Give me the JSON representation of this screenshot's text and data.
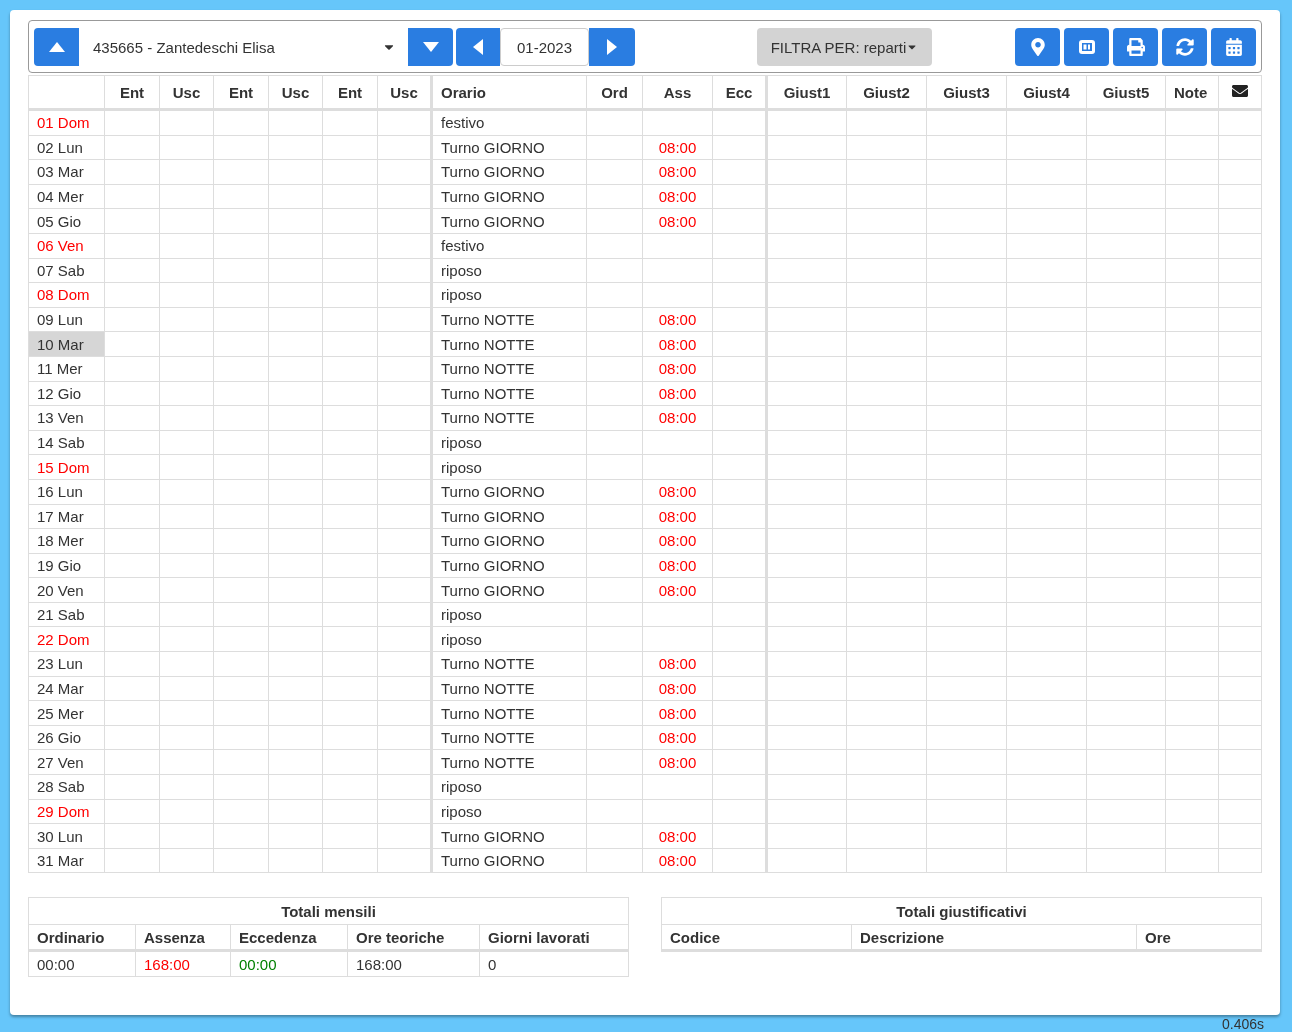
{
  "employee_select": {
    "value": "435665 - Zantedeschi Elisa"
  },
  "month_field": {
    "value": "01-2023"
  },
  "filter_button": {
    "label": "FILTRA PER: reparti"
  },
  "table": {
    "columns": [
      "Ent",
      "Usc",
      "Ent",
      "Usc",
      "Ent",
      "Usc",
      "Orario",
      "Ord",
      "Ass",
      "Ecc",
      "Giust1",
      "Giust2",
      "Giust3",
      "Giust4",
      "Giust5",
      "Note"
    ],
    "rows": [
      {
        "day": "01 Dom",
        "holiday": true,
        "selected": false,
        "orario": "festivo"
      },
      {
        "day": "02 Lun",
        "holiday": false,
        "selected": false,
        "orario": "Turno GIORNO",
        "ass": "08:00"
      },
      {
        "day": "03 Mar",
        "holiday": false,
        "selected": false,
        "orario": "Turno GIORNO",
        "ass": "08:00"
      },
      {
        "day": "04 Mer",
        "holiday": false,
        "selected": false,
        "orario": "Turno GIORNO",
        "ass": "08:00"
      },
      {
        "day": "05 Gio",
        "holiday": false,
        "selected": false,
        "orario": "Turno GIORNO",
        "ass": "08:00"
      },
      {
        "day": "06 Ven",
        "holiday": true,
        "selected": false,
        "orario": "festivo"
      },
      {
        "day": "07 Sab",
        "holiday": false,
        "selected": false,
        "orario": "riposo"
      },
      {
        "day": "08 Dom",
        "holiday": true,
        "selected": false,
        "orario": "riposo"
      },
      {
        "day": "09 Lun",
        "holiday": false,
        "selected": false,
        "orario": "Turno NOTTE",
        "ass": "08:00"
      },
      {
        "day": "10 Mar",
        "holiday": false,
        "selected": true,
        "orario": "Turno NOTTE",
        "ass": "08:00"
      },
      {
        "day": "11 Mer",
        "holiday": false,
        "selected": false,
        "orario": "Turno NOTTE",
        "ass": "08:00"
      },
      {
        "day": "12 Gio",
        "holiday": false,
        "selected": false,
        "orario": "Turno NOTTE",
        "ass": "08:00"
      },
      {
        "day": "13 Ven",
        "holiday": false,
        "selected": false,
        "orario": "Turno NOTTE",
        "ass": "08:00"
      },
      {
        "day": "14 Sab",
        "holiday": false,
        "selected": false,
        "orario": "riposo"
      },
      {
        "day": "15 Dom",
        "holiday": true,
        "selected": false,
        "orario": "riposo"
      },
      {
        "day": "16 Lun",
        "holiday": false,
        "selected": false,
        "orario": "Turno GIORNO",
        "ass": "08:00"
      },
      {
        "day": "17 Mar",
        "holiday": false,
        "selected": false,
        "orario": "Turno GIORNO",
        "ass": "08:00"
      },
      {
        "day": "18 Mer",
        "holiday": false,
        "selected": false,
        "orario": "Turno GIORNO",
        "ass": "08:00"
      },
      {
        "day": "19 Gio",
        "holiday": false,
        "selected": false,
        "orario": "Turno GIORNO",
        "ass": "08:00"
      },
      {
        "day": "20 Ven",
        "holiday": false,
        "selected": false,
        "orario": "Turno GIORNO",
        "ass": "08:00"
      },
      {
        "day": "21 Sab",
        "holiday": false,
        "selected": false,
        "orario": "riposo"
      },
      {
        "day": "22 Dom",
        "holiday": true,
        "selected": false,
        "orario": "riposo"
      },
      {
        "day": "23 Lun",
        "holiday": false,
        "selected": false,
        "orario": "Turno NOTTE",
        "ass": "08:00"
      },
      {
        "day": "24 Mar",
        "holiday": false,
        "selected": false,
        "orario": "Turno NOTTE",
        "ass": "08:00"
      },
      {
        "day": "25 Mer",
        "holiday": false,
        "selected": false,
        "orario": "Turno NOTTE",
        "ass": "08:00"
      },
      {
        "day": "26 Gio",
        "holiday": false,
        "selected": false,
        "orario": "Turno NOTTE",
        "ass": "08:00"
      },
      {
        "day": "27 Ven",
        "holiday": false,
        "selected": false,
        "orario": "Turno NOTTE",
        "ass": "08:00"
      },
      {
        "day": "28 Sab",
        "holiday": false,
        "selected": false,
        "orario": "riposo"
      },
      {
        "day": "29 Dom",
        "holiday": true,
        "selected": false,
        "orario": "riposo"
      },
      {
        "day": "30 Lun",
        "holiday": false,
        "selected": false,
        "orario": "Turno GIORNO",
        "ass": "08:00"
      },
      {
        "day": "31 Mar",
        "holiday": false,
        "selected": false,
        "orario": "Turno GIORNO",
        "ass": "08:00"
      }
    ]
  },
  "monthly_totals": {
    "title": "Totali mensili",
    "columns": [
      "Ordinario",
      "Assenza",
      "Eccedenza",
      "Ore teoriche",
      "Giorni lavorati"
    ],
    "values": [
      {
        "text": "00:00",
        "color": "#333333"
      },
      {
        "text": "168:00",
        "color": "#ff0000"
      },
      {
        "text": "00:00",
        "color": "#008000"
      },
      {
        "text": "168:00",
        "color": "#333333"
      },
      {
        "text": "0",
        "color": "#333333"
      }
    ]
  },
  "justification_totals": {
    "title": "Totali giustificativi",
    "columns": [
      "Codice",
      "Descrizione",
      "Ore"
    ]
  },
  "timing": "0.406s"
}
